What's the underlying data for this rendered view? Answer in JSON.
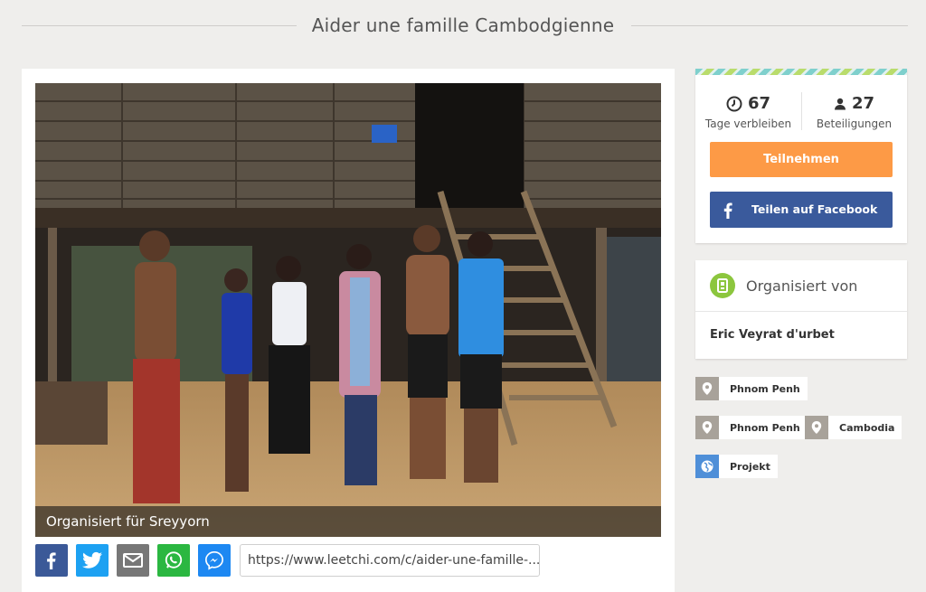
{
  "page": {
    "title": "Aider une famille Cambodgienne"
  },
  "photo": {
    "caption": "Organisiert für Sreyyorn"
  },
  "share": {
    "link": "https://www.leetchi.com/c/aider-une-famille-...",
    "buttons": [
      {
        "name": "facebook",
        "color": "#3b5998",
        "icon": "facebook-icon"
      },
      {
        "name": "twitter",
        "color": "#1da1f2",
        "icon": "twitter-icon"
      },
      {
        "name": "email",
        "color": "#777777",
        "icon": "mail-icon"
      },
      {
        "name": "whatsapp",
        "color": "#2bb741",
        "icon": "whatsapp-icon"
      },
      {
        "name": "messenger",
        "color": "#1d88f2",
        "icon": "messenger-icon"
      }
    ]
  },
  "stats": {
    "days": {
      "value": "67",
      "label": "Tage verbleiben",
      "icon": "clock-icon"
    },
    "participants": {
      "value": "27",
      "label": "Beteiligungen",
      "icon": "person-icon"
    }
  },
  "actions": {
    "participate_label": "Teilnehmen",
    "participate_color": "#fd9a46",
    "facebook_label": "Teilen auf Facebook",
    "facebook_color": "#3a5a9c"
  },
  "organizer": {
    "title": "Organisiert von",
    "name": "Eric Veyrat d'urbet",
    "icon": "badge-icon"
  },
  "tags": [
    {
      "label": "Phnom Penh",
      "icon": "location-pin-icon"
    },
    {
      "label": "Phnom Penh",
      "icon": "location-pin-icon"
    },
    {
      "label": "Cambodia",
      "icon": "location-pin-icon"
    },
    {
      "label": "Projekt",
      "icon": "globe-icon"
    }
  ]
}
